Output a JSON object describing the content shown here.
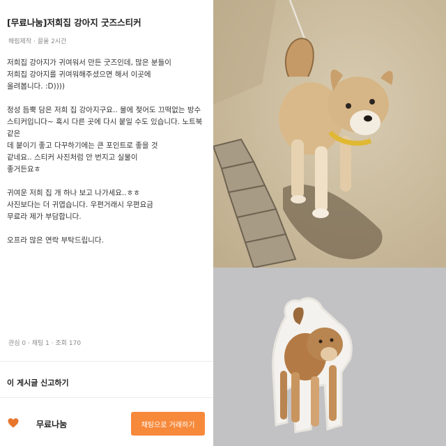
{
  "post": {
    "title": "[무료나눔]저희집 강아지 굿즈스티커",
    "meta": "해림제작 · 끌올 2시간",
    "paragraphs": [
      "저희집 강아지가 귀여워서 만든 굿즈인데, 많은 분들이\n저희집 강아지를 귀여워해주셨으면 해서 이곳에\n올려봅니다. :D))))",
      "정성 듬뿍 담은 저희 집 강아지구요.. 물에 젖어도 끄떡없는 방수\n스티커입니다~ 혹시 다른 곳에 다시 붙일 수도 있습니다. 노트북 같은\n데 붙이기 좋고 다꾸하기에는 큰 포인트로 좋을 것\n같네요.. 스티커 사진처럼 안 번지고 실물이\n좋거든요ㅎ",
      "귀여운 저희 집 개 하나 보고 나가세요..ㅎㅎ\n사진보다는 더 귀엽습니다. 우편거래시 우편요금\n무료라 제가 부담합니다.",
      "오프라 많은 연락 부탁드립니다."
    ],
    "stats": "관심 0 · 채팅 1 · 조회 170"
  },
  "report_label": "이 게시글 신고하기",
  "bottom": {
    "seller_name": "무료나눔",
    "chat_button": "채팅으로 거래하기",
    "heart_icon": "heart-icon"
  },
  "colors": {
    "accent": "#f7893a",
    "heart": "#e8762d"
  }
}
